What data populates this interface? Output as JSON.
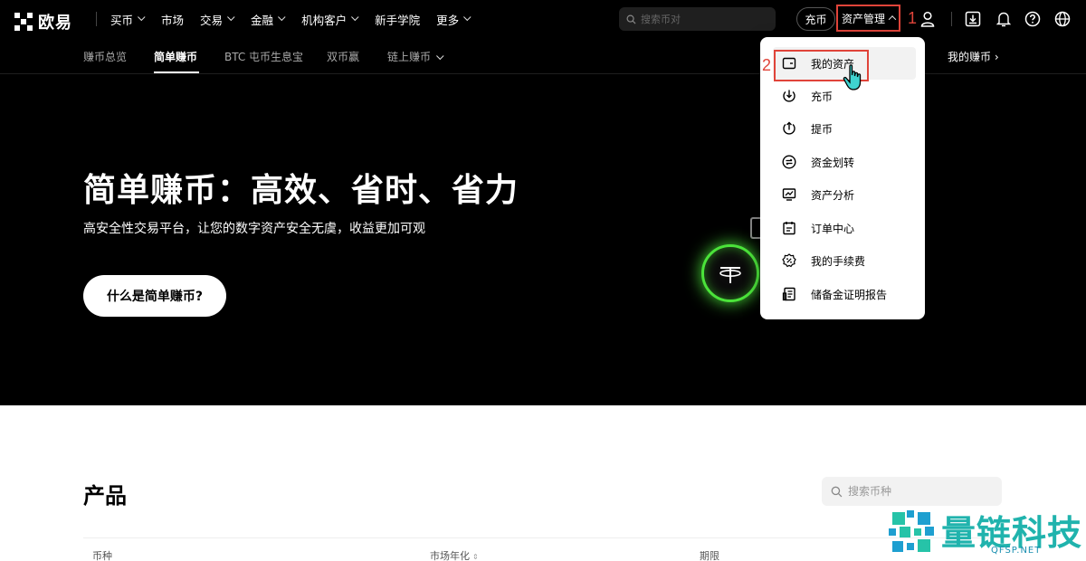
{
  "header": {
    "brand": "欧易",
    "menu": [
      {
        "label": "买币",
        "has_dropdown": true
      },
      {
        "label": "市场",
        "has_dropdown": false
      },
      {
        "label": "交易",
        "has_dropdown": true
      },
      {
        "label": "金融",
        "has_dropdown": true
      },
      {
        "label": "机构客户",
        "has_dropdown": true
      },
      {
        "label": "新手学院",
        "has_dropdown": false
      },
      {
        "label": "更多",
        "has_dropdown": true
      }
    ],
    "search_placeholder": "搜索币对",
    "deposit_label": "充币",
    "asset_mgmt_label": "资产管理",
    "icons": [
      "user-icon",
      "download-icon",
      "bell-icon",
      "help-icon",
      "globe-icon"
    ]
  },
  "annotations": {
    "step1": "1",
    "step2": "2"
  },
  "subnav": {
    "tabs": [
      {
        "label": "赚币总览",
        "active": false
      },
      {
        "label": "简单赚币",
        "active": true
      },
      {
        "label": "BTC 屯币生息宝",
        "active": false
      },
      {
        "label": "双币赢",
        "active": false
      },
      {
        "label": "链上赚币",
        "active": false
      }
    ],
    "my_earn": "我的赚币 ›"
  },
  "hero": {
    "title": "简单赚币：高效、省时、省力",
    "subtitle": "高安全性交易平台，让您的数字资产安全无虞，收益更加可观",
    "button": "什么是简单赚币?"
  },
  "dropdown": {
    "items": [
      {
        "label": "我的资产",
        "icon": "wallet-icon"
      },
      {
        "label": "充币",
        "icon": "deposit-icon"
      },
      {
        "label": "提币",
        "icon": "withdraw-icon"
      },
      {
        "label": "资金划转",
        "icon": "transfer-icon"
      },
      {
        "label": "资产分析",
        "icon": "analysis-icon"
      },
      {
        "label": "订单中心",
        "icon": "order-icon"
      },
      {
        "label": "我的手续费",
        "icon": "fee-icon"
      },
      {
        "label": "储备金证明报告",
        "icon": "report-icon"
      }
    ]
  },
  "products": {
    "title": "产品",
    "search_placeholder": "搜索币种",
    "columns": [
      "币种",
      "市场年化",
      "期限"
    ]
  },
  "watermark": {
    "text": "量链科技",
    "url": "QFSP.NET"
  },
  "colors": {
    "annotation": "#e0443a",
    "coin_glow": "#4be33a",
    "watermark": "#20b3ad"
  }
}
